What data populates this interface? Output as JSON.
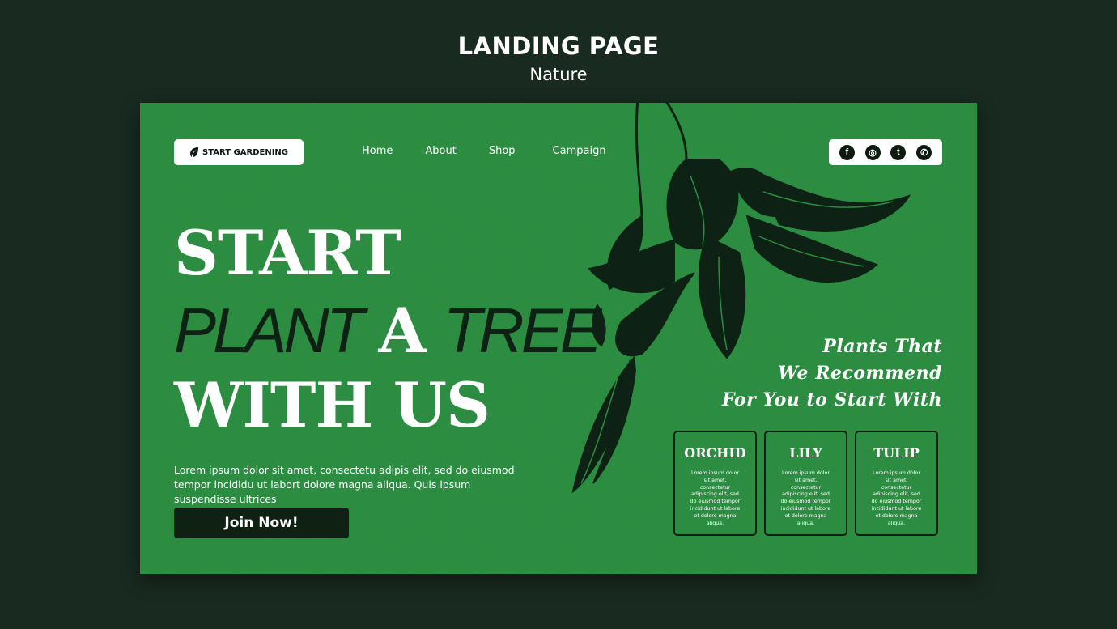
{
  "header": {
    "title": "LANDING PAGE",
    "subtitle": "Nature"
  },
  "logo": {
    "label": "START GARDENING",
    "icon": "leaf-icon"
  },
  "nav": [
    "Home",
    "About",
    "Shop",
    "Campaign"
  ],
  "social": [
    {
      "name": "facebook-icon",
      "glyph": "f"
    },
    {
      "name": "instagram-icon",
      "glyph": "◎"
    },
    {
      "name": "twitter-icon",
      "glyph": "t"
    },
    {
      "name": "whatsapp-icon",
      "glyph": "✆"
    }
  ],
  "hero": {
    "line1": "START",
    "line2_a": "PLANT",
    "line2_b": "A",
    "line2_c": "TREE",
    "line3": "WITH US",
    "description": "Lorem ipsum dolor sit amet, consectetu adipis elit, sed do eiusmod tempor incididu ut labort dolore magna aliqua. Quis ipsum suspendisse ultrices",
    "cta": "Join Now!"
  },
  "recommend": [
    "Plants That",
    "We Recommend",
    "For You to Start With"
  ],
  "plants": [
    {
      "name": "ORCHID",
      "text": "Lorem ipsum dolor sit amet, consectetur adipiscing elit, sed do eiusmod tempor incididunt ut labore et dolore magna aliqua."
    },
    {
      "name": "LILY",
      "text": "Lorem ipsum dolor sit amet, consectetur adipiscing elit, sed do eiusmod tempor incididunt ut labore et dolore magna aliqua."
    },
    {
      "name": "TULIP",
      "text": "Lorem ipsum dolor sit amet, consectetur adipiscing elit, sed do eiusmod tempor incididunt ut labore et dolore magna aliqua."
    }
  ],
  "colors": {
    "background": "#192a20",
    "card": "#2a8e3f",
    "dark": "#0d2214",
    "text": "#ffffff"
  }
}
